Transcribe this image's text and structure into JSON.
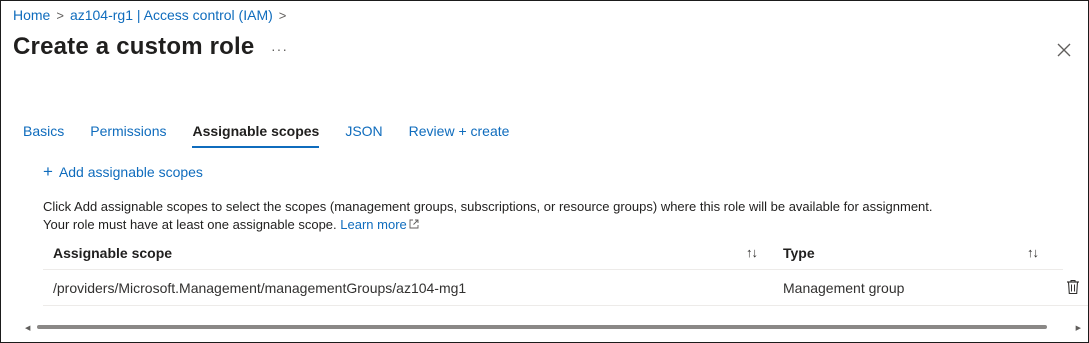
{
  "breadcrumb": {
    "items": [
      "Home",
      "az104-rg1 | Access control (IAM)"
    ],
    "separator": ">"
  },
  "header": {
    "title": "Create a custom role",
    "more_label": "···"
  },
  "tabs": [
    {
      "label": "Basics",
      "active": false
    },
    {
      "label": "Permissions",
      "active": false
    },
    {
      "label": "Assignable scopes",
      "active": true
    },
    {
      "label": "JSON",
      "active": false
    },
    {
      "label": "Review + create",
      "active": false
    }
  ],
  "toolbar": {
    "add_icon": "+",
    "add_label": "Add assignable scopes"
  },
  "description": {
    "line1": "Click Add assignable scopes to select the scopes (management groups, subscriptions, or resource groups) where this role will be available for assignment.",
    "line2": "Your role must have at least one assignable scope.",
    "learn_more": "Learn more"
  },
  "table": {
    "columns": [
      "Assignable scope",
      "Type"
    ],
    "sort_icon": "↑↓",
    "rows": [
      {
        "scope": "/providers/Microsoft.Management/managementGroups/az104-mg1",
        "type": "Management group"
      }
    ]
  },
  "colors": {
    "accent": "#0f6cbd",
    "text": "#201f1e",
    "divider": "#edebe9"
  },
  "icons": [
    "chevron-right-icon",
    "more-icon",
    "close-icon",
    "plus-icon",
    "external-link-icon",
    "sort-icon",
    "trash-icon"
  ]
}
